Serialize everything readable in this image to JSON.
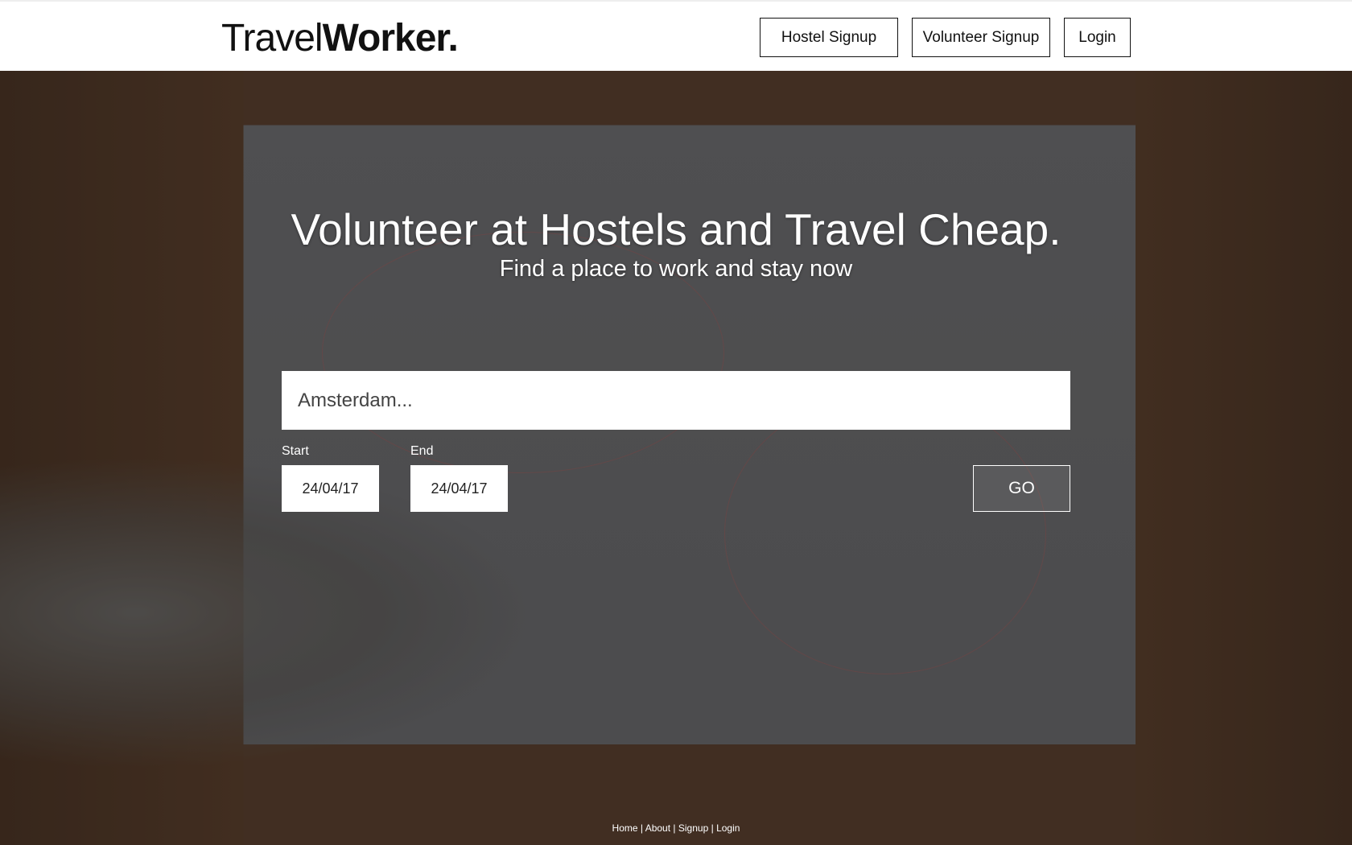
{
  "header": {
    "logo_light": "Travel",
    "logo_bold": "Worker.",
    "nav": [
      {
        "label": "Hostel Signup"
      },
      {
        "label": "Volunteer Signup"
      },
      {
        "label": "Login"
      }
    ]
  },
  "hero": {
    "title": "Volunteer at Hostels and Travel Cheap.",
    "subtitle": "Find a place to work and stay now",
    "search": {
      "placeholder": "Amsterdam...",
      "value": ""
    },
    "start": {
      "label": "Start",
      "value": "24/04/17"
    },
    "end": {
      "label": "End",
      "value": "24/04/17"
    },
    "go_label": "GO"
  },
  "footer": {
    "links": [
      "Home",
      "About",
      "Signup",
      "Login"
    ],
    "separator": "|"
  }
}
